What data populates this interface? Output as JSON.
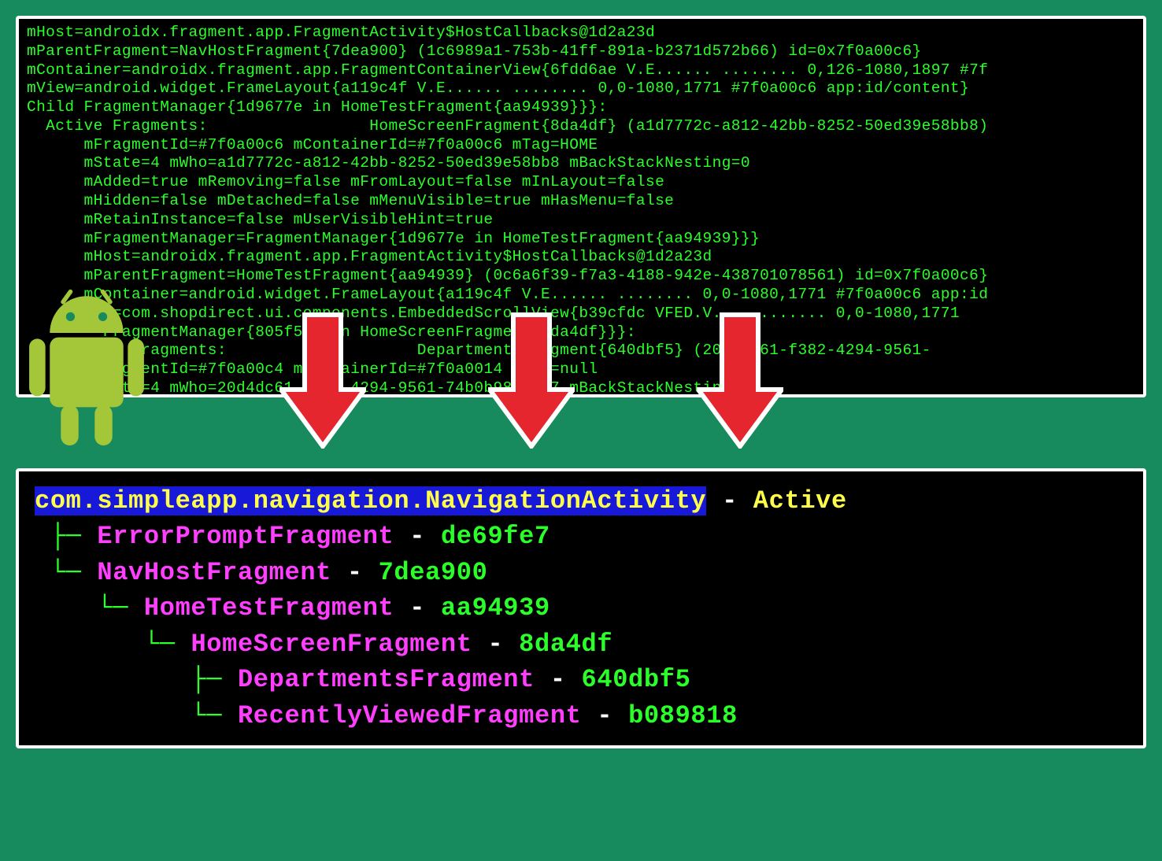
{
  "dump": {
    "lines": [
      "mHost=androidx.fragment.app.FragmentActivity$HostCallbacks@1d2a23d",
      "mParentFragment=NavHostFragment{7dea900} (1c6989a1-753b-41ff-891a-b2371d572b66) id=0x7f0a00c6}",
      "mContainer=androidx.fragment.app.FragmentContainerView{6fdd6ae V.E...... ........ 0,126-1080,1897 #7f",
      "mView=android.widget.FrameLayout{a119c4f V.E...... ........ 0,0-1080,1771 #7f0a00c6 app:id/content}",
      "Child FragmentManager{1d9677e in HomeTestFragment{aa94939}}}:",
      "  Active Fragments:                 HomeScreenFragment{8da4df} (a1d7772c-a812-42bb-8252-50ed39e58bb8)",
      "      mFragmentId=#7f0a00c6 mContainerId=#7f0a00c6 mTag=HOME",
      "      mState=4 mWho=a1d7772c-a812-42bb-8252-50ed39e58bb8 mBackStackNesting=0",
      "      mAdded=true mRemoving=false mFromLayout=false mInLayout=false",
      "      mHidden=false mDetached=false mMenuVisible=true mHasMenu=false",
      "      mRetainInstance=false mUserVisibleHint=true",
      "      mFragmentManager=FragmentManager{1d9677e in HomeTestFragment{aa94939}}}",
      "      mHost=androidx.fragment.app.FragmentActivity$HostCallbacks@1d2a23d",
      "      mParentFragment=HomeTestFragment{aa94939} (0c6a6f39-f7a3-4188-942e-438701078561) id=0x7f0a00c6}",
      "      mContainer=android.widget.FrameLayout{a119c4f V.E...... ........ 0,0-1080,1771 #7f0a00c6 app:id",
      "        w=com.shopdirect.ui.components.EmbeddedScrollView{b39cfdc VFED.V... ........ 0,0-1080,1771",
      "        FragmentManager{805f52c in HomeScreenFragment{8da4df}}}:",
      "        ve Fragments:                    DepartmentsFragment{640dbf5} (20d4dc61-f382-4294-9561-",
      "         agmentId=#7f0a00c4 mContainerId=#7f0a0014 mTag=null",
      "         ate=4 mWho=20d4dc61-f382-4294-9561-74b0b98e7087 mBackStackNesting=0"
    ]
  },
  "tree": {
    "activity": {
      "name": "com.simpleapp.navigation.NavigationActivity",
      "status": "Active"
    },
    "nodes": [
      {
        "branch": " ├─ ",
        "name": "ErrorPromptFragment",
        "hash": "de69fe7"
      },
      {
        "branch": " └─ ",
        "name": "NavHostFragment",
        "hash": "7dea900"
      },
      {
        "branch": "    └─ ",
        "name": "HomeTestFragment",
        "hash": "aa94939"
      },
      {
        "branch": "       └─ ",
        "name": "HomeScreenFragment",
        "hash": "8da4df"
      },
      {
        "branch": "          ├─ ",
        "name": "DepartmentsFragment",
        "hash": "640dbf5"
      },
      {
        "branch": "          └─ ",
        "name": "RecentlyViewedFragment",
        "hash": "b089818"
      }
    ]
  },
  "separator": " - "
}
